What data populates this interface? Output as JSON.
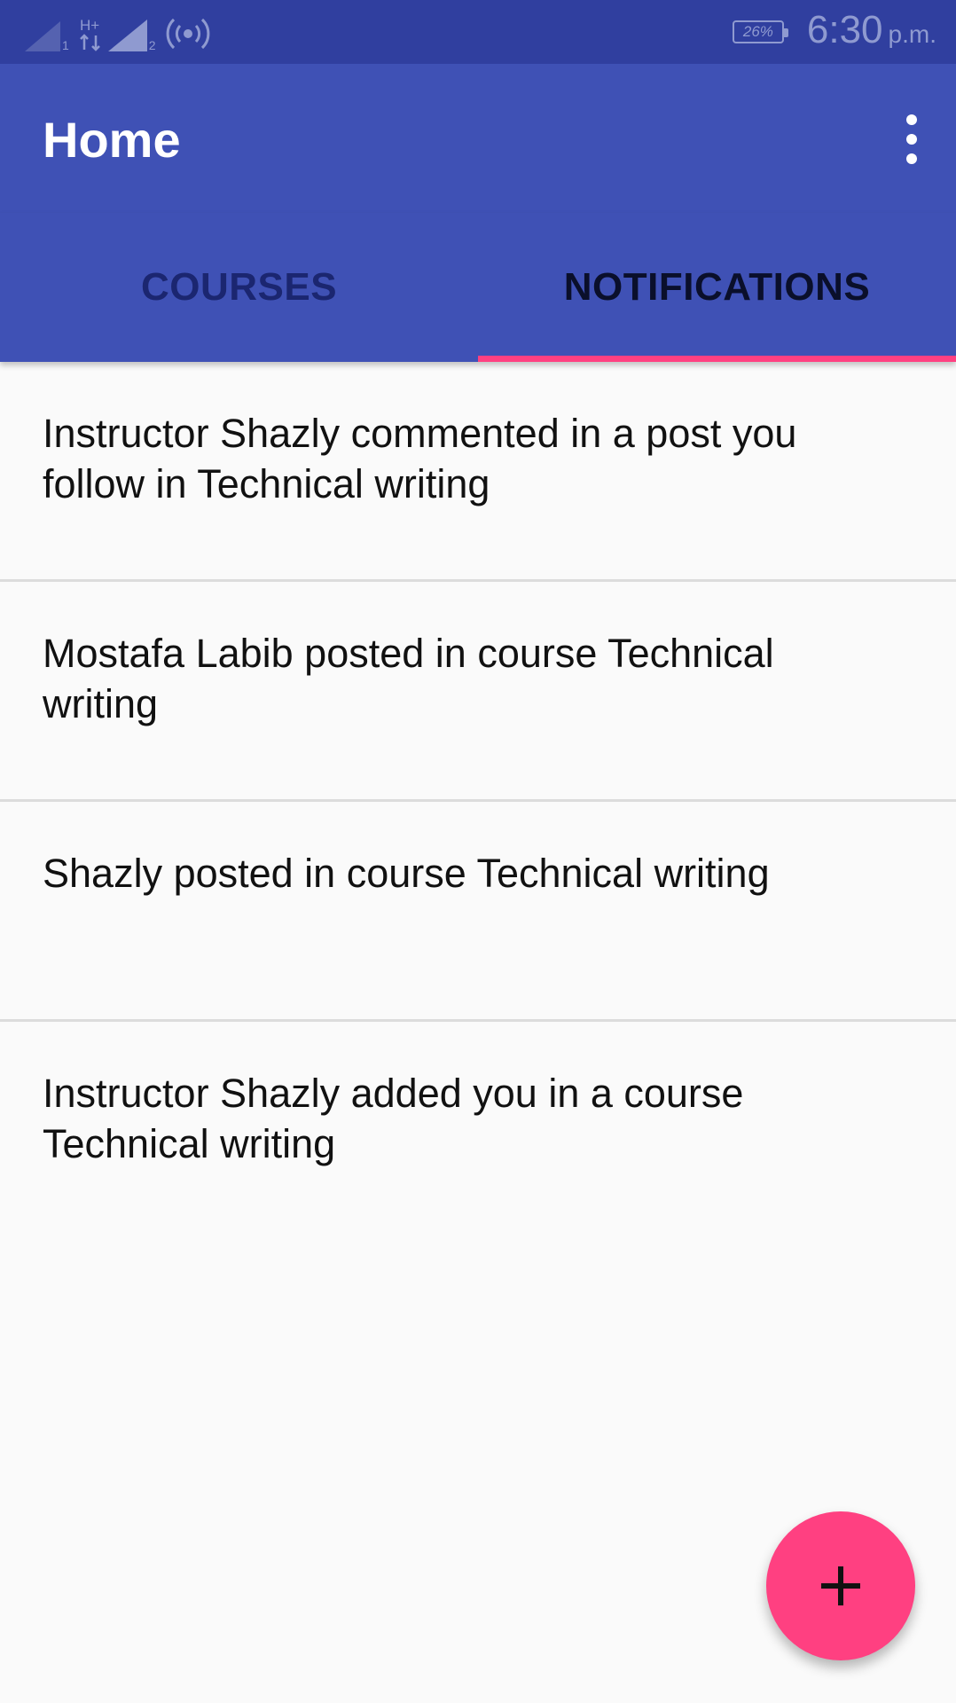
{
  "status_bar": {
    "sim1_label": "1",
    "network_type": "H+",
    "sim2_label": "2",
    "battery": "26%",
    "time": "6:30",
    "ampm": "p.m.",
    "icon_color": "#8f9ad0"
  },
  "app_bar": {
    "title": "Home",
    "menu_icon": "overflow-menu-icon",
    "background": "#3f51b5"
  },
  "tabs": [
    {
      "label": "COURSES",
      "selected": false
    },
    {
      "label": "NOTIFICATIONS",
      "selected": true
    }
  ],
  "notifications": [
    {
      "text": "Instructor Shazly commented in  a post you follow in Technical writing"
    },
    {
      "text": "Mostafa Labib posted in course Technical writing"
    },
    {
      "text": "Shazly posted in course Technical writing"
    },
    {
      "text": "Instructor Shazly added you in a course Technical writing"
    }
  ],
  "fab": {
    "icon": "plus-icon",
    "color": "#ff4081"
  }
}
